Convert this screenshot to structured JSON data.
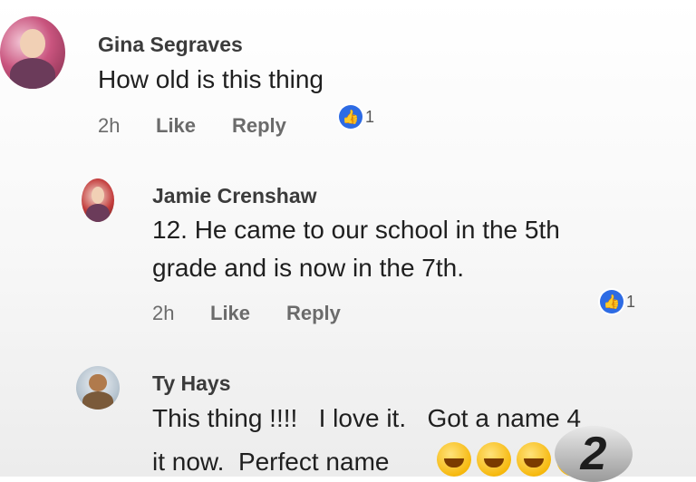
{
  "comments": [
    {
      "name": "Gina Segraves",
      "lines": [
        "How old is this thing"
      ],
      "time": "2h",
      "like_label": "Like",
      "reply_label": "Reply",
      "like_count": "1"
    },
    {
      "name": "Jamie Crenshaw",
      "lines": [
        "12. He came to our school in the 5th",
        "grade and is now in the 7th."
      ],
      "time": "2h",
      "like_label": "Like",
      "reply_label": "Reply",
      "like_count": "1"
    },
    {
      "name": "Ty Hays",
      "lines": [
        "This thing !!!!   I love it.   Got a name 4",
        "it now.  Perfect name"
      ]
    }
  ],
  "emoji": {
    "name": "laughing-emoji",
    "count": 4
  },
  "logo": {
    "text": "2"
  },
  "colors": {
    "like_badge": "#2d6be4",
    "name": "#3b3b3b",
    "meta": "#6b6b6b"
  }
}
